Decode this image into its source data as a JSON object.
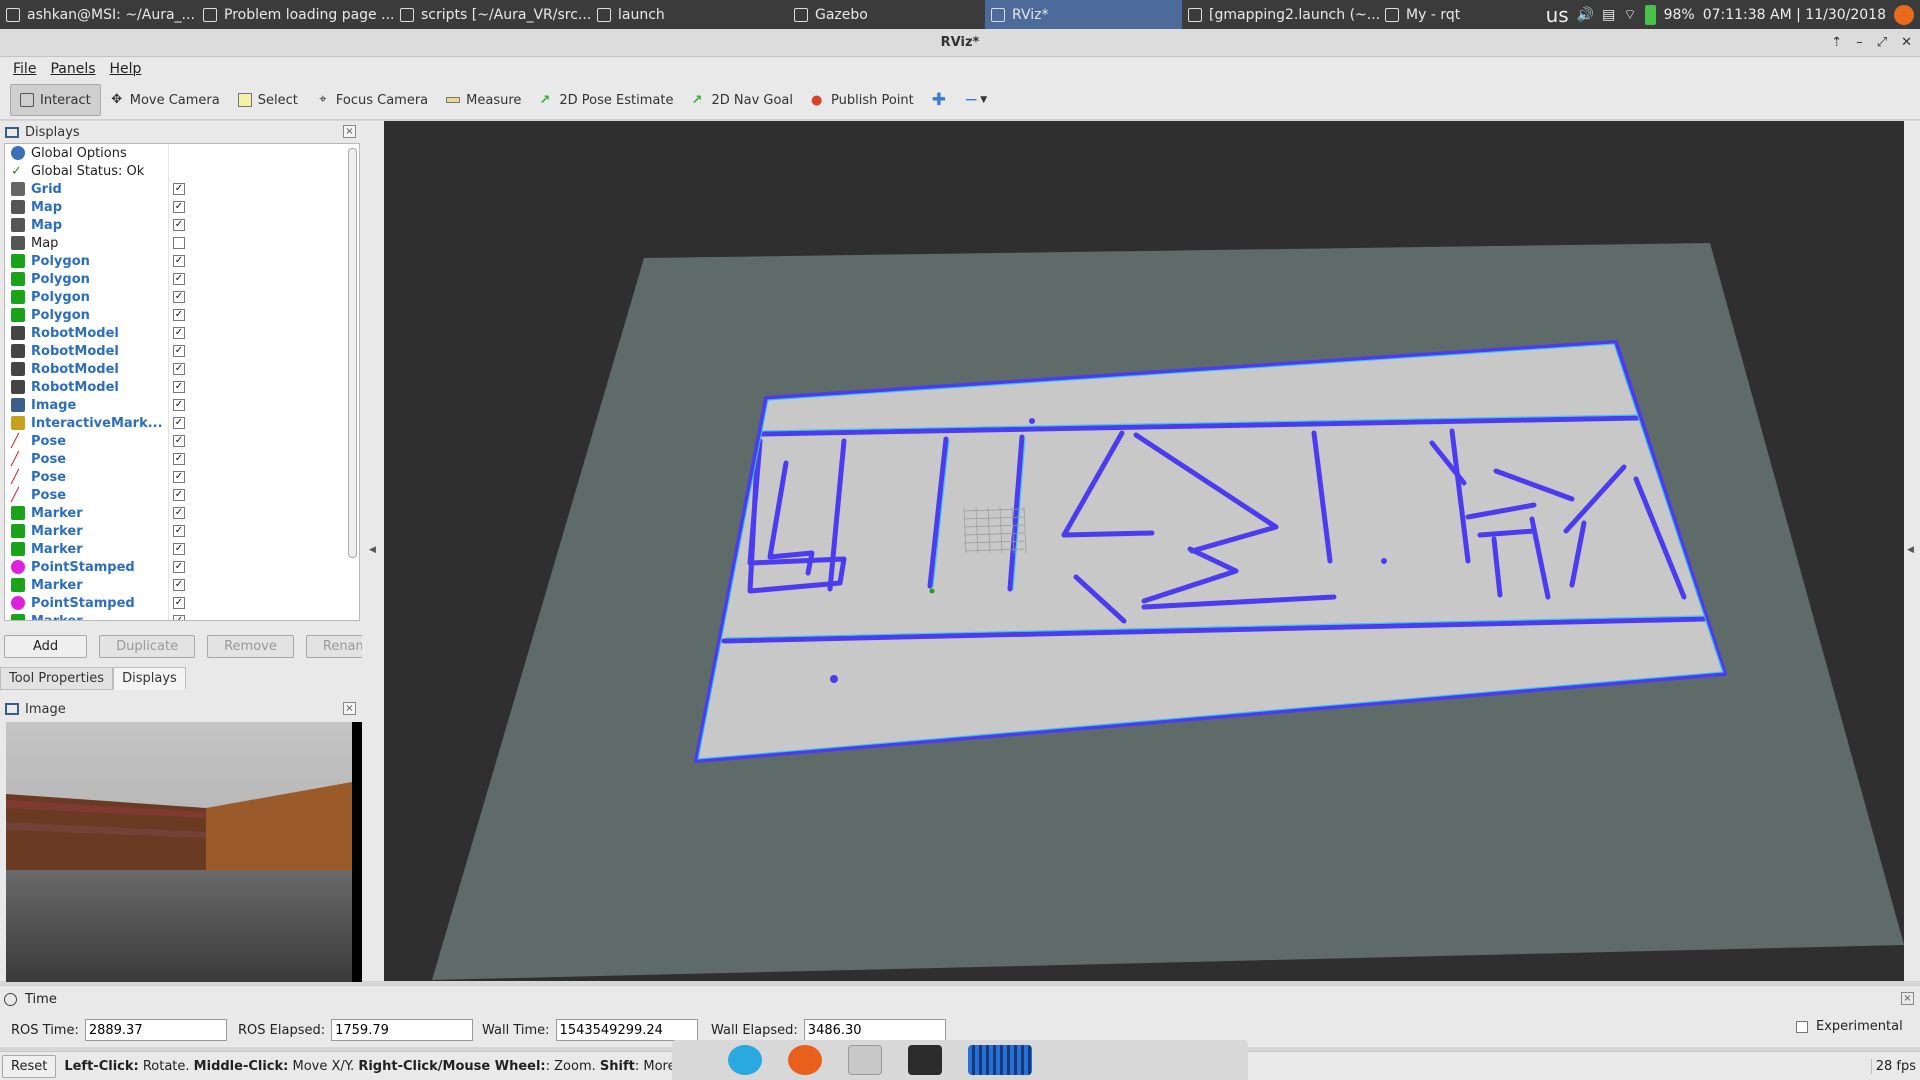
{
  "taskbar": {
    "tasks": [
      {
        "label": "ashkan@MSI: ~/Aura_...",
        "icon": "terminal-icon",
        "active": false
      },
      {
        "label": "Problem loading page ...",
        "icon": "firefox-icon",
        "active": false
      },
      {
        "label": "scripts [~/Aura_VR/src...",
        "icon": "pycharm-icon",
        "active": false
      },
      {
        "label": "launch",
        "icon": "folder-icon",
        "active": false
      },
      {
        "label": "Gazebo",
        "icon": "gazebo-icon",
        "active": false
      },
      {
        "label": "RViz*",
        "icon": "rviz-icon",
        "active": true
      },
      {
        "label": "[gmapping2.launch (~...",
        "icon": "editor-icon",
        "active": false
      },
      {
        "label": "My - rqt",
        "icon": "grid-icon",
        "active": false
      }
    ],
    "tray": {
      "keyboard": "us",
      "battery": "98%",
      "datetime": "07:11:38 AM | 11/30/2018"
    }
  },
  "window": {
    "title": "RViz*"
  },
  "menu": {
    "file": "File",
    "panels": "Panels",
    "help": "Help"
  },
  "toolbar": {
    "interact": "Interact",
    "move_camera": "Move Camera",
    "select": "Select",
    "focus_camera": "Focus Camera",
    "measure": "Measure",
    "pose_estimate": "2D Pose Estimate",
    "nav_goal": "2D Nav Goal",
    "publish_point": "Publish Point"
  },
  "displays": {
    "title": "Displays",
    "items": [
      {
        "label": "Global Options",
        "bold": false,
        "checkbox": null,
        "icon": "gear-icon",
        "color": "#3b6fb6"
      },
      {
        "label": "Global Status: Ok",
        "bold": false,
        "checkbox": null,
        "icon": "check-icon",
        "color": "#2a8a2a"
      },
      {
        "label": "Grid",
        "bold": true,
        "checkbox": true,
        "icon": "grid-icon",
        "color": "#666666"
      },
      {
        "label": "Map",
        "bold": true,
        "checkbox": true,
        "icon": "map-icon",
        "color": "#555555"
      },
      {
        "label": "Map",
        "bold": true,
        "checkbox": true,
        "icon": "map-icon",
        "color": "#555555"
      },
      {
        "label": "Map",
        "bold": false,
        "checkbox": false,
        "icon": "map-icon",
        "color": "#555555"
      },
      {
        "label": "Polygon",
        "bold": true,
        "checkbox": true,
        "icon": "polygon-icon",
        "color": "#1aa31a"
      },
      {
        "label": "Polygon",
        "bold": true,
        "checkbox": true,
        "icon": "polygon-icon",
        "color": "#1aa31a"
      },
      {
        "label": "Polygon",
        "bold": true,
        "checkbox": true,
        "icon": "polygon-icon",
        "color": "#1aa31a"
      },
      {
        "label": "Polygon",
        "bold": true,
        "checkbox": true,
        "icon": "polygon-icon",
        "color": "#1aa31a"
      },
      {
        "label": "RobotModel",
        "bold": true,
        "checkbox": true,
        "icon": "robot-icon",
        "color": "#444444"
      },
      {
        "label": "RobotModel",
        "bold": true,
        "checkbox": true,
        "icon": "robot-icon",
        "color": "#444444"
      },
      {
        "label": "RobotModel",
        "bold": true,
        "checkbox": true,
        "icon": "robot-icon",
        "color": "#444444"
      },
      {
        "label": "RobotModel",
        "bold": true,
        "checkbox": true,
        "icon": "robot-icon",
        "color": "#444444"
      },
      {
        "label": "Image",
        "bold": true,
        "checkbox": true,
        "icon": "image-icon",
        "color": "#3b5e8f"
      },
      {
        "label": "InteractiveMark...",
        "bold": true,
        "checkbox": true,
        "icon": "interactive-marker-icon",
        "color": "#c8a020"
      },
      {
        "label": "Pose",
        "bold": true,
        "checkbox": true,
        "icon": "pose-arrow-icon",
        "color": "#cc2222"
      },
      {
        "label": "Pose",
        "bold": true,
        "checkbox": true,
        "icon": "pose-arrow-icon",
        "color": "#cc2222"
      },
      {
        "label": "Pose",
        "bold": true,
        "checkbox": true,
        "icon": "pose-arrow-icon",
        "color": "#cc2222"
      },
      {
        "label": "Pose",
        "bold": true,
        "checkbox": true,
        "icon": "pose-arrow-icon",
        "color": "#cc2222"
      },
      {
        "label": "Marker",
        "bold": true,
        "checkbox": true,
        "icon": "marker-cube-icon",
        "color": "#1aa31a"
      },
      {
        "label": "Marker",
        "bold": true,
        "checkbox": true,
        "icon": "marker-cube-icon",
        "color": "#1aa31a"
      },
      {
        "label": "Marker",
        "bold": true,
        "checkbox": true,
        "icon": "marker-cube-icon",
        "color": "#1aa31a"
      },
      {
        "label": "PointStamped",
        "bold": true,
        "checkbox": true,
        "icon": "point-icon",
        "color": "#dd22dd"
      },
      {
        "label": "Marker",
        "bold": true,
        "checkbox": true,
        "icon": "marker-cube-icon",
        "color": "#1aa31a"
      },
      {
        "label": "PointStamped",
        "bold": true,
        "checkbox": true,
        "icon": "point-icon",
        "color": "#dd22dd"
      },
      {
        "label": "Marker",
        "bold": true,
        "checkbox": true,
        "icon": "marker-cube-icon",
        "color": "#1aa31a"
      }
    ],
    "buttons": {
      "add": "Add",
      "duplicate": "Duplicate",
      "remove": "Remove",
      "rename": "Rename"
    }
  },
  "tabs": {
    "tool_properties": "Tool Properties",
    "displays": "Displays"
  },
  "image_panel": {
    "title": "Image"
  },
  "time": {
    "title": "Time",
    "ros_time_label": "ROS Time:",
    "ros_time": "2889.37",
    "ros_elapsed_label": "ROS Elapsed:",
    "ros_elapsed": "1759.79",
    "wall_time_label": "Wall Time:",
    "wall_time": "1543549299.24",
    "wall_elapsed_label": "Wall Elapsed:",
    "wall_elapsed": "3486.30",
    "experimental": "Experimental"
  },
  "status": {
    "reset": "Reset",
    "hint_prefix_1": "Left-Click:",
    "hint_text_1": " Rotate. ",
    "hint_prefix_2": "Middle-Click:",
    "hint_text_2": " Move X/Y. ",
    "hint_prefix_3": "Right-Click/Mouse Wheel:",
    "hint_text_3": ": Zoom. ",
    "hint_prefix_4": "Shift",
    "hint_text_4": ": More options.",
    "fps": "28 fps"
  },
  "colors": {
    "accent": "#4c6a9a",
    "map_free": "#c8c8c8",
    "map_unknown": "#5e6b69",
    "wall": "#4b3cf0"
  }
}
